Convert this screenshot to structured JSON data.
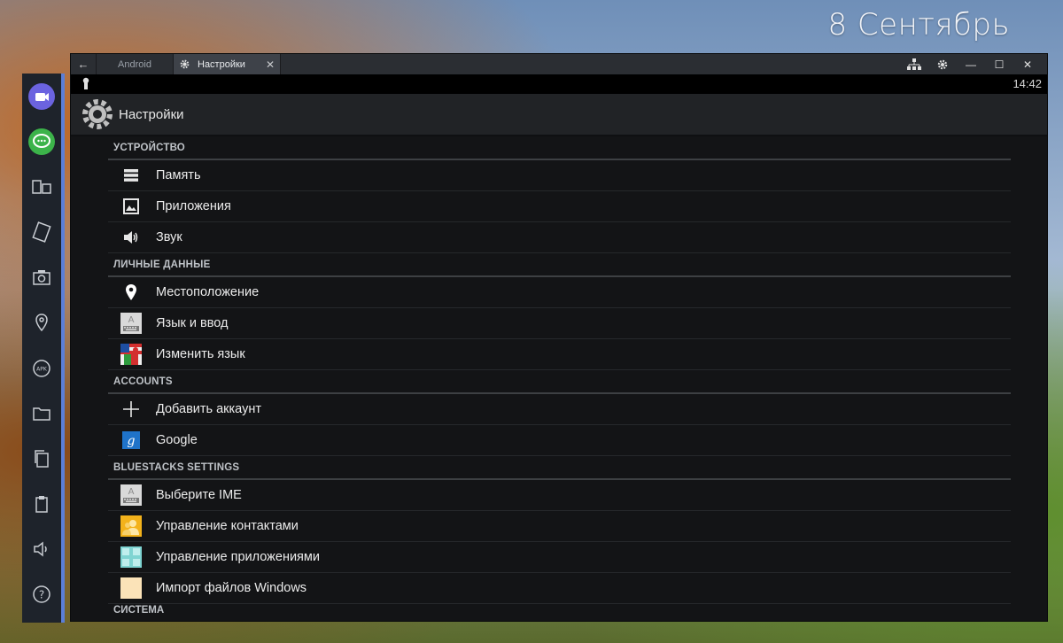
{
  "desktop": {
    "date": "8 Сентябрь"
  },
  "window": {
    "tabs": [
      {
        "label": "Android"
      },
      {
        "label": "Настройки"
      }
    ],
    "controls": [
      "layout-icon",
      "gear-icon",
      "minimize-icon",
      "maximize-icon",
      "close-icon"
    ]
  },
  "status": {
    "time": "14:42"
  },
  "actionbar": {
    "title": "Настройки"
  },
  "sections": {
    "device": {
      "header": "УСТРОЙСТВО",
      "items": [
        {
          "label": "Память",
          "icon": "storage-icon"
        },
        {
          "label": "Приложения",
          "icon": "apps-icon"
        },
        {
          "label": "Звук",
          "icon": "speaker-icon"
        }
      ]
    },
    "personal": {
      "header": "ЛИЧНЫЕ ДАННЫЕ",
      "items": [
        {
          "label": "Местоположение",
          "icon": "location-icon"
        },
        {
          "label": "Язык и ввод",
          "icon": "keyboard-icon"
        },
        {
          "label": "Изменить язык",
          "icon": "flag-icon"
        }
      ]
    },
    "accounts": {
      "header": "ACCOUNTS",
      "items": [
        {
          "label": "Добавить аккаунт",
          "icon": "plus-icon"
        },
        {
          "label": "Google",
          "icon": "google-icon"
        }
      ]
    },
    "bluestacks": {
      "header": "BLUESTACKS SETTINGS",
      "items": [
        {
          "label": "Выберите IME",
          "icon": "keyboard-icon"
        },
        {
          "label": "Управление контактами",
          "icon": "contacts-icon"
        },
        {
          "label": "Управление приложениями",
          "icon": "app-manager-icon"
        },
        {
          "label": "Импорт файлов Windows",
          "icon": "folder-import-icon"
        }
      ]
    },
    "system": {
      "header": "СИСТЕМА"
    }
  },
  "colors": {
    "accent": "#5b7fd8",
    "background": "#131416"
  }
}
